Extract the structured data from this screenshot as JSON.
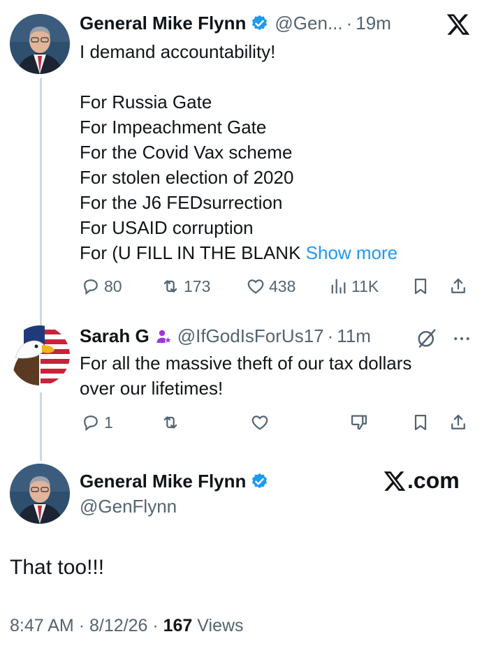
{
  "tweet1": {
    "name": "General Mike Flynn",
    "handle": "@Gen...",
    "time": "19m",
    "lines": [
      "I demand accountability!",
      "",
      "For Russia Gate",
      "For Impeachment Gate",
      "For the Covid Vax scheme",
      "For stolen election of 2020",
      "For the J6 FEDsurrection",
      "For USAID corruption",
      "For (U FILL IN THE BLANK"
    ],
    "show_more": "Show more",
    "replies": "80",
    "reposts": "173",
    "likes": "438",
    "views": "11K"
  },
  "tweet2": {
    "name": "Sarah G",
    "handle": "@IfGodIsForUs17",
    "time": "11m",
    "lines": [
      "For all the massive theft of our tax dollars",
      "over our lifetimes!"
    ],
    "replies": "1"
  },
  "tweet3": {
    "name": "General Mike Flynn",
    "handle": "@GenFlynn",
    "brand": ".com",
    "text": "That too!!!",
    "time": "8:47 AM",
    "date": "8/12/26",
    "views_count": "167",
    "views_label": "Views"
  },
  "separator": "·",
  "colors": {
    "verified": "#1d9bf0",
    "link": "#1d9bf0",
    "muted": "#536471",
    "subscriber_badge": "#a335d9"
  }
}
